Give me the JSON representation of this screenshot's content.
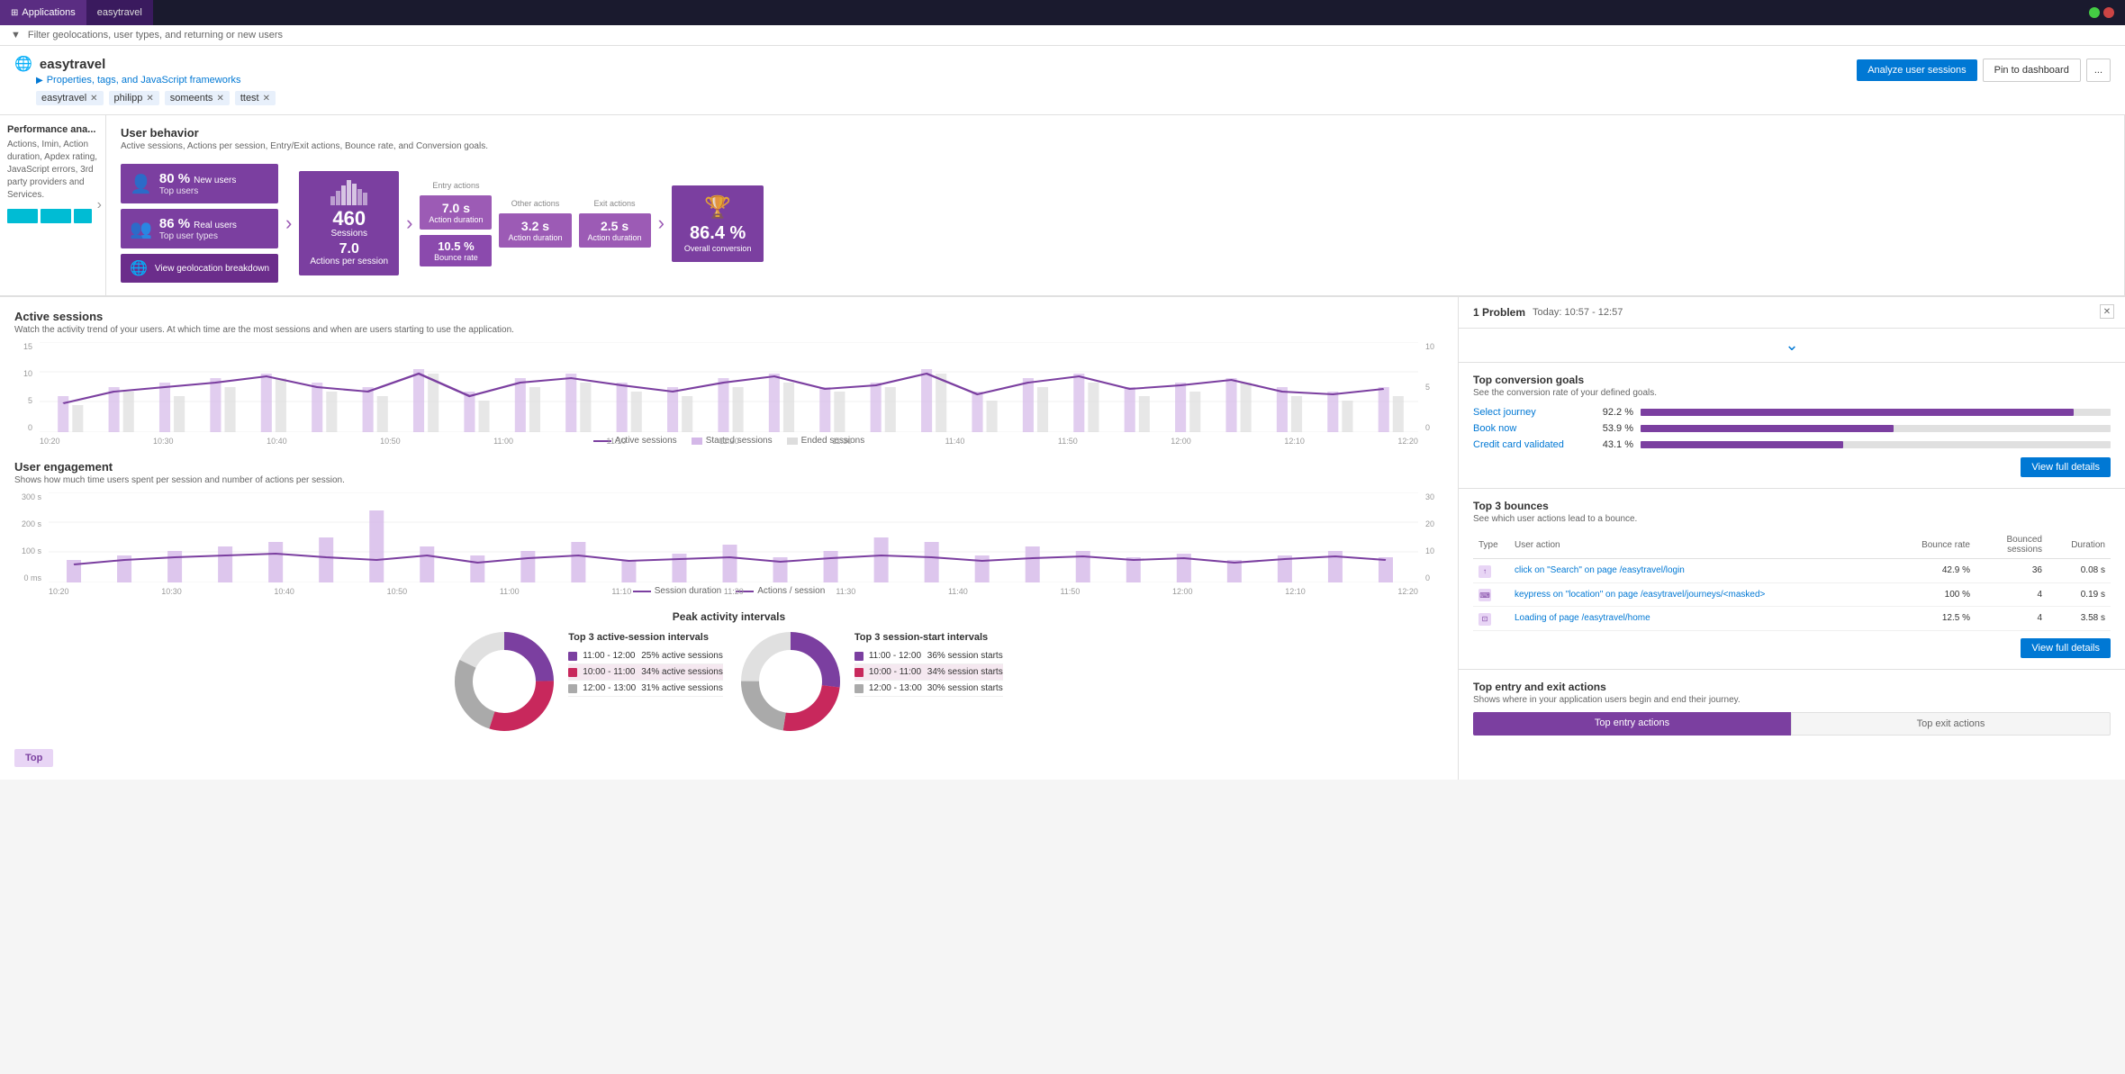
{
  "nav": {
    "items": [
      {
        "label": "Applications",
        "active": true
      },
      {
        "label": "easytravel",
        "active": true
      }
    ]
  },
  "filter": {
    "text": "Filter geolocations, user types, and returning or new users"
  },
  "app": {
    "title": "easytravel",
    "subtitle": "Properties, tags, and JavaScript frameworks",
    "tags": [
      "easytravel",
      "philipp",
      "someents",
      "ttest"
    ],
    "buttons": {
      "analyze": "Analyze user sessions",
      "pin": "Pin to dashboard",
      "more": "..."
    }
  },
  "left_panel": {
    "title": "Performance ana...",
    "subtitle": "Actions, Imin, Action duration, Apdex rating, JavaScript errors, 3rd party providers and Services."
  },
  "user_behavior": {
    "title": "User behavior",
    "subtitle": "Active sessions, Actions per session, Entry/Exit actions, Bounce rate, and Conversion goals.",
    "new_users_pct": "80 %",
    "new_users_label": "New users",
    "new_users_sub": "Top users",
    "real_users_pct": "86 %",
    "real_users_label": "Real users",
    "real_users_sub": "Top user types",
    "geo_label": "View geolocation breakdown",
    "sessions_count": "460",
    "sessions_label": "Sessions",
    "actions_count": "7.0",
    "actions_label": "Actions per session",
    "entry_duration": "7.0 s",
    "entry_label": "Action duration",
    "other_duration": "3.2 s",
    "other_label": "Action duration",
    "exit_duration": "2.5 s",
    "exit_label": "Action duration",
    "bounce_rate": "10.5 %",
    "bounce_label": "Bounce rate",
    "conversion": "86.4 %",
    "conversion_label": "Overall conversion"
  },
  "active_sessions": {
    "title": "Active sessions",
    "subtitle": "Watch the activity trend of your users. At which time are the most sessions and when are users starting to use the application.",
    "y_max": "15",
    "y_mid": "10",
    "y_low": "5",
    "y_min": "0",
    "y_right_max": "10",
    "y_right_mid": "5",
    "y_right_min": "0",
    "legend": [
      "Active sessions",
      "Started sessions",
      "Ended sessions"
    ],
    "x_labels": [
      "10:20",
      "10:30",
      "10:40",
      "10:50",
      "11:00",
      "11:10",
      "11:20",
      "11:30",
      "11:40",
      "11:50",
      "12:00",
      "12:10",
      "12:20"
    ]
  },
  "user_engagement": {
    "title": "User engagement",
    "subtitle": "Shows how much time users spent per session and number of actions per session.",
    "y_max": "300 s",
    "y_mid": "200 s",
    "y_low": "100 s",
    "y_min": "0 ms",
    "y_right_max": "30",
    "y_right_mid": "20",
    "y_right_low": "10",
    "y_right_min": "0",
    "legend": [
      "Session duration",
      "Actions / session"
    ]
  },
  "peak_intervals": {
    "title": "Peak activity intervals",
    "active_title": "Top 3 active-session intervals",
    "start_title": "Top 3 session-start intervals",
    "active_rows": [
      {
        "color": "#7b3fa0",
        "time": "11:00 - 12:00",
        "value": "25% active sessions"
      },
      {
        "color": "#c8285c",
        "time": "10:00 - 11:00",
        "value": "34% active sessions"
      },
      {
        "color": "#666",
        "time": "12:00 - 13:00",
        "value": "31% active sessions"
      }
    ],
    "start_rows": [
      {
        "color": "#7b3fa0",
        "time": "11:00 - 12:00",
        "value": "36% session starts"
      },
      {
        "color": "#c8285c",
        "time": "10:00 - 11:00",
        "value": "34% session starts"
      },
      {
        "color": "#666",
        "time": "12:00 - 13:00",
        "value": "30% session starts"
      }
    ]
  },
  "problem": {
    "count": "1 Problem",
    "time": "Today: 10:57 - 12:57"
  },
  "conversion_goals": {
    "title": "Top conversion goals",
    "subtitle": "See the conversion rate of your defined goals.",
    "goals": [
      {
        "name": "Select journey",
        "pct": "92.2 %",
        "fill": 92.2
      },
      {
        "name": "Book now",
        "pct": "53.9 %",
        "fill": 53.9
      },
      {
        "name": "Credit card validated",
        "pct": "43.1 %",
        "fill": 43.1
      }
    ],
    "view_button": "View full details"
  },
  "top_bounces": {
    "title": "Top 3 bounces",
    "subtitle": "See which user actions lead to a bounce.",
    "columns": [
      "Type",
      "User action",
      "Bounce rate",
      "Bounced sessions",
      "Duration"
    ],
    "rows": [
      {
        "type": "click",
        "action": "click on \"Search\" on page /easytravel/login",
        "bounce_rate": "42.9 %",
        "bounced": "36",
        "duration": "0.08 s"
      },
      {
        "type": "keypress",
        "action": "keypress on \"location\" on page /easytravel/journeys/<masked>",
        "bounce_rate": "100 %",
        "bounced": "4",
        "duration": "0.19 s"
      },
      {
        "type": "load",
        "action": "Loading of page /easytravel/home",
        "bounce_rate": "12.5 %",
        "bounced": "4",
        "duration": "3.58 s"
      }
    ],
    "view_button": "View full details"
  },
  "entry_exit": {
    "title": "Top entry and exit actions",
    "subtitle": "Shows where in your application users begin and end their journey.",
    "tabs": [
      "Top entry actions",
      "Top exit actions"
    ]
  }
}
